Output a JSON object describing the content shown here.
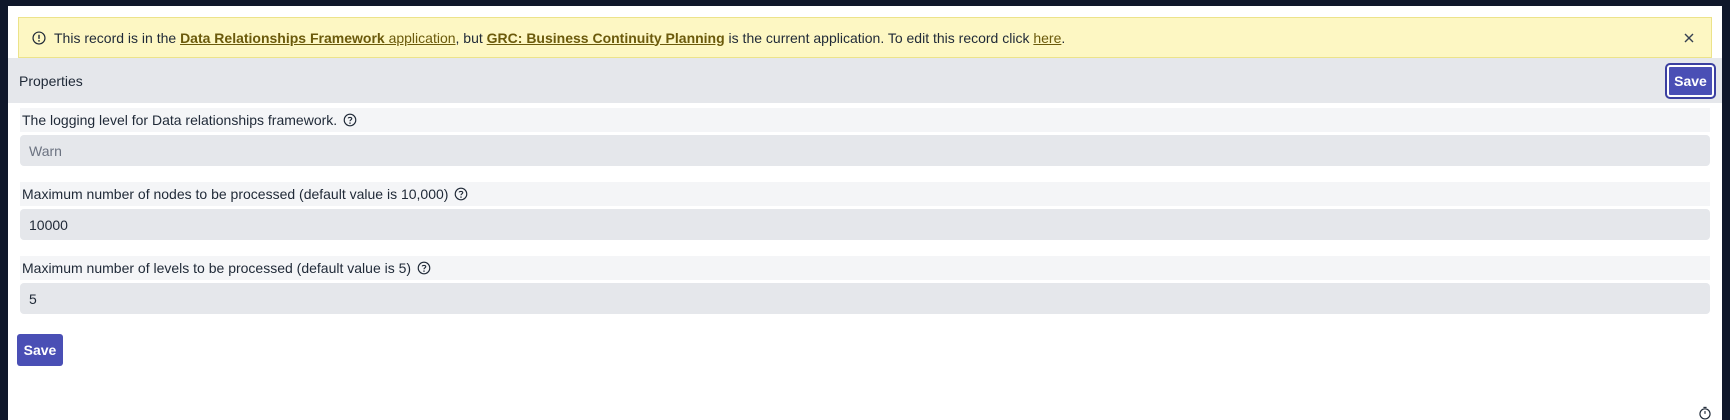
{
  "banner": {
    "text_before": "This record is in the ",
    "app_link_bold": "Data Relationships Framework",
    "app_link_plain": " application",
    "text_mid": ", but ",
    "current_app_link": "GRC: Business Continuity Planning",
    "text_after": " is the current application. To edit this record click ",
    "here_link": "here",
    "text_end": "."
  },
  "header": {
    "title": "Properties",
    "save_label": "Save"
  },
  "fields": [
    {
      "label": "The logging level for Data relationships framework.",
      "value": "Warn"
    },
    {
      "label": "Maximum number of nodes to be processed (default value is 10,000)",
      "value": "10000"
    },
    {
      "label": "Maximum number of levels to be processed (default value is 5)",
      "value": "5"
    }
  ],
  "footer": {
    "save_label": "Save"
  },
  "colors": {
    "banner_bg": "#fdf7c3",
    "primary": "#4a4fb5",
    "panel": "#e5e7eb"
  }
}
